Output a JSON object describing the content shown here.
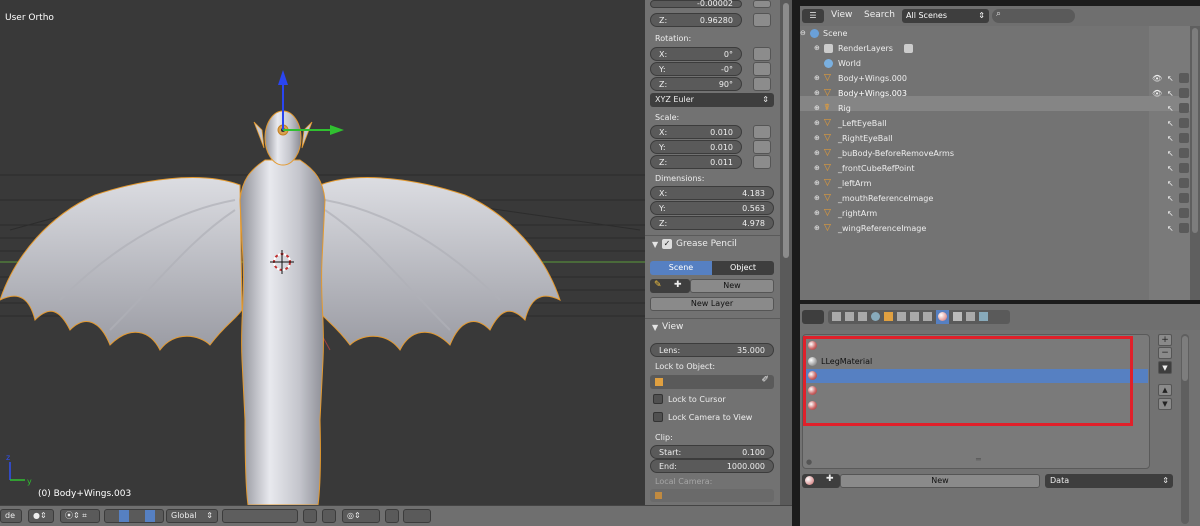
{
  "viewport": {
    "view_label": "User Ortho",
    "object_label": "(0) Body+Wings.003"
  },
  "npanel": {
    "partial_y_value": "-0.00002",
    "location_z": {
      "label": "Z:",
      "value": "0.96280"
    },
    "rotation_label": "Rotation:",
    "rotation": [
      {
        "label": "X:",
        "value": "0°"
      },
      {
        "label": "Y:",
        "value": "-0°"
      },
      {
        "label": "Z:",
        "value": "90°"
      }
    ],
    "rotation_mode": "XYZ Euler",
    "scale_label": "Scale:",
    "scale": [
      {
        "label": "X:",
        "value": "0.010"
      },
      {
        "label": "Y:",
        "value": "0.010"
      },
      {
        "label": "Z:",
        "value": "0.011"
      }
    ],
    "dimensions_label": "Dimensions:",
    "dimensions": [
      {
        "label": "X:",
        "value": "4.183"
      },
      {
        "label": "Y:",
        "value": "0.563"
      },
      {
        "label": "Z:",
        "value": "4.978"
      }
    ],
    "grease_pencil": {
      "title": "Grease Pencil",
      "tab_scene": "Scene",
      "tab_object": "Object",
      "new_label": "New",
      "new_layer_label": "New Layer"
    },
    "view": {
      "title": "View",
      "lens_label": "Lens:",
      "lens_value": "35.000",
      "lock_to_object_label": "Lock to Object:",
      "lock_to_cursor": "Lock to Cursor",
      "lock_camera": "Lock Camera to View",
      "clip_label": "Clip:",
      "clip_start_label": "Start:",
      "clip_start_value": "0.100",
      "clip_end_label": "End:",
      "clip_end_value": "1000.000",
      "local_camera_label": "Local Camera:"
    }
  },
  "outliner": {
    "view_menu": "View",
    "search_menu": "Search",
    "filter": "All Scenes",
    "rows": [
      {
        "name": "Scene",
        "type": "scene"
      },
      {
        "name": "RenderLayers",
        "type": "render"
      },
      {
        "name": "World",
        "type": "world"
      },
      {
        "name": "Body+Wings.000",
        "type": "mesh"
      },
      {
        "name": "Body+Wings.003",
        "type": "mesh"
      },
      {
        "name": "Rig",
        "type": "armature"
      },
      {
        "name": "_LeftEyeBall",
        "type": "mesh"
      },
      {
        "name": "_RightEyeBall",
        "type": "mesh"
      },
      {
        "name": "_buBody-BeforeRemoveArms",
        "type": "mesh"
      },
      {
        "name": "_frontCubeRefPoint",
        "type": "mesh"
      },
      {
        "name": "_leftArm",
        "type": "mesh"
      },
      {
        "name": "_mouthReferenceImage",
        "type": "mesh"
      },
      {
        "name": "_rightArm",
        "type": "mesh"
      },
      {
        "name": "_wingReferenceImage",
        "type": "mesh"
      }
    ]
  },
  "properties": {
    "material_slots": [
      "",
      "LLegMaterial",
      "",
      "",
      ""
    ],
    "selected_slot_index": 2,
    "new_label": "New",
    "data_label": "Data"
  },
  "bottom_header": {
    "mode_partial": "de",
    "orientation": "Global"
  },
  "colors": {
    "accent_blue": "#5680c2",
    "highlight_red": "#e0202a",
    "selection_orange": "#f0a030"
  }
}
